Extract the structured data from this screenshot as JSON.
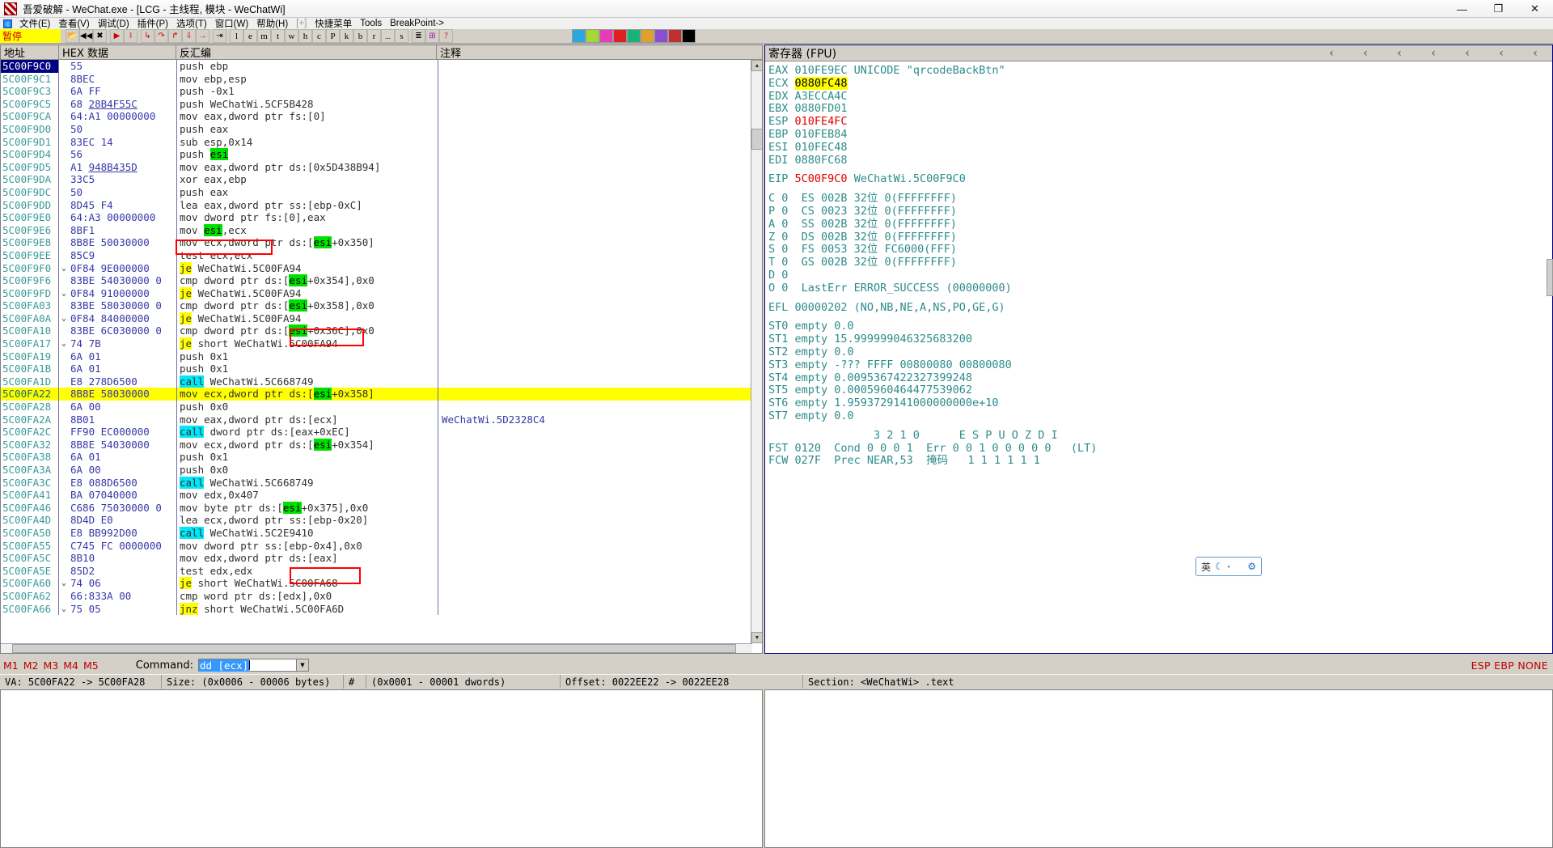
{
  "window": {
    "title": "吾爱破解 - WeChat.exe - [LCG -  主线程, 模块 - WeChatWi]",
    "minimize": "—",
    "maximize": "❐",
    "close": "✕",
    "app_icon": "app-logo-icon"
  },
  "menu": {
    "items": [
      {
        "label": "文件(E)"
      },
      {
        "label": "查看(V)"
      },
      {
        "label": "调试(D)"
      },
      {
        "label": "插件(P)"
      },
      {
        "label": "选项(T)"
      },
      {
        "label": "窗口(W)"
      },
      {
        "label": "帮助(H)"
      },
      {
        "label": "[+]",
        "dim": true
      },
      {
        "label": "快捷菜单"
      },
      {
        "label": "Tools"
      },
      {
        "label": "BreakPoint->"
      }
    ]
  },
  "toolbar": {
    "status_label": "暂停",
    "buttons": [
      {
        "name": "open-file-button",
        "glyph": "📂"
      },
      {
        "name": "restart-button",
        "glyph": "◀◀"
      },
      {
        "name": "close-button",
        "glyph": "✖"
      },
      {
        "name": "run-button",
        "glyph": "▶"
      },
      {
        "name": "pause-button",
        "glyph": "‖"
      },
      {
        "name": "step-into-button",
        "glyph": "↳"
      },
      {
        "name": "step-over-button",
        "glyph": "↷"
      },
      {
        "name": "step-out-button",
        "glyph": "↱"
      },
      {
        "name": "run-to-return-button",
        "glyph": "⇩"
      },
      {
        "name": "execute-till-return-button",
        "glyph": "→"
      },
      {
        "name": "run-to-selection-button",
        "glyph": "⇥"
      }
    ],
    "letters": [
      "l",
      "e",
      "m",
      "t",
      "w",
      "h",
      "c",
      "P",
      "k",
      "b",
      "r"
    ],
    "letters2": [
      "s"
    ],
    "more_label": "...",
    "extra_buttons": [
      {
        "name": "list-view-button",
        "glyph": "≣"
      },
      {
        "name": "window-list-button",
        "glyph": "⊞"
      },
      {
        "name": "help-button",
        "glyph": "?"
      }
    ],
    "color_buttons": [
      {
        "name": "patch-icon",
        "color": "#29a7e0"
      },
      {
        "name": "hide-icon",
        "color": "#a5d833"
      },
      {
        "name": "attach-icon",
        "color": "#e93bb4"
      },
      {
        "name": "scylla-icon",
        "color": "#e02020"
      },
      {
        "name": "plugin1-icon",
        "color": "#19b37a"
      },
      {
        "name": "plugin2-icon",
        "color": "#e0a030"
      },
      {
        "name": "plugin3-icon",
        "color": "#8a4fd0"
      },
      {
        "name": "plugin4-icon",
        "color": "#c03030"
      },
      {
        "name": "black-icon",
        "color": "#000000"
      }
    ]
  },
  "disasm": {
    "headers": [
      "地址",
      "HEX 数据",
      "反汇编",
      "注释"
    ],
    "rows": [
      {
        "addr": "5C00F9C0",
        "hex": "55",
        "asm": "push ebp",
        "cmt": "",
        "selected": true
      },
      {
        "addr": "5C00F9C1",
        "hex": "8BEC",
        "asm": "mov ebp,esp",
        "cmt": ""
      },
      {
        "addr": "5C00F9C3",
        "hex": "6A FF",
        "asm": "push -0x1",
        "cmt": ""
      },
      {
        "addr": "5C00F9C5",
        "hex": "68 28B4F55C",
        "asm": "push WeChatWi.5CF5B428",
        "cmt": "",
        "hex_ul": true
      },
      {
        "addr": "5C00F9CA",
        "hex": "64:A1 00000000",
        "asm": "mov eax,dword ptr fs:[0]",
        "cmt": ""
      },
      {
        "addr": "5C00F9D0",
        "hex": "50",
        "asm": "push eax",
        "cmt": ""
      },
      {
        "addr": "5C00F9D1",
        "hex": "83EC 14",
        "asm": "sub esp,0x14",
        "cmt": ""
      },
      {
        "addr": "5C00F9D4",
        "hex": "56",
        "asm": "push |esi|",
        "cmt": ""
      },
      {
        "addr": "5C00F9D5",
        "hex": "A1 948B435D",
        "asm": "mov eax,dword ptr ds:[0x5D438B94]",
        "cmt": "",
        "hex_ul": true
      },
      {
        "addr": "5C00F9DA",
        "hex": "33C5",
        "asm": "xor eax,ebp",
        "cmt": ""
      },
      {
        "addr": "5C00F9DC",
        "hex": "50",
        "asm": "push eax",
        "cmt": ""
      },
      {
        "addr": "5C00F9DD",
        "hex": "8D45 F4",
        "asm": "lea eax,dword ptr ss:[ebp-0xC]",
        "cmt": ""
      },
      {
        "addr": "5C00F9E0",
        "hex": "64:A3 00000000",
        "asm": "mov dword ptr fs:[0],eax",
        "cmt": ""
      },
      {
        "addr": "5C00F9E6",
        "hex": "8BF1",
        "asm": "mov |esi|,ecx",
        "cmt": ""
      },
      {
        "addr": "5C00F9E8",
        "hex": "8B8E 50030000",
        "asm": "mov ecx,dword ptr ds:[|esi|+0x350]",
        "cmt": ""
      },
      {
        "addr": "5C00F9EE",
        "hex": "85C9",
        "asm": "test ecx,ecx",
        "cmt": ""
      },
      {
        "addr": "5C00F9F0",
        "hex": "0F84 9E000000",
        "asm": "#je# WeChatWi.5C00FA94",
        "cmt": "",
        "arrow": "⌄"
      },
      {
        "addr": "5C00F9F6",
        "hex": "83BE 54030000 0",
        "asm": "cmp dword ptr ds:[|esi|+0x354],0x0",
        "cmt": ""
      },
      {
        "addr": "5C00F9FD",
        "hex": "0F84 91000000",
        "asm": "#je# WeChatWi.5C00FA94",
        "cmt": "",
        "arrow": "⌄"
      },
      {
        "addr": "5C00FA03",
        "hex": "83BE 58030000 0",
        "asm": "cmp dword ptr ds:[|esi|+0x358],0x0",
        "cmt": ""
      },
      {
        "addr": "5C00FA0A",
        "hex": "0F84 84000000",
        "asm": "#je# WeChatWi.5C00FA94",
        "cmt": "",
        "arrow": "⌄"
      },
      {
        "addr": "5C00FA10",
        "hex": "83BE 6C030000 0",
        "asm": "cmp dword ptr ds:[|esi|+0x36C],0x0",
        "cmt": ""
      },
      {
        "addr": "5C00FA17",
        "hex": "74 7B",
        "asm": "#je# short WeChatWi.5C00FA94",
        "cmt": "",
        "arrow": "⌄"
      },
      {
        "addr": "5C00FA19",
        "hex": "6A 01",
        "asm": "push 0x1",
        "cmt": ""
      },
      {
        "addr": "5C00FA1B",
        "hex": "6A 01",
        "asm": "push 0x1",
        "cmt": ""
      },
      {
        "addr": "5C00FA1D",
        "hex": "E8 278D6500",
        "asm": "@call@ WeChatWi.5C668749",
        "cmt": ""
      },
      {
        "addr": "5C00FA22",
        "hex": "8B8E 58030000",
        "asm": "mov ecx,dword ptr ds:[|esi|+0x358]",
        "cmt": "",
        "highlight": true
      },
      {
        "addr": "5C00FA28",
        "hex": "6A 00",
        "asm": "push 0x0",
        "cmt": ""
      },
      {
        "addr": "5C00FA2A",
        "hex": "8B01",
        "asm": "mov eax,dword ptr ds:[ecx]",
        "cmt": "WeChatWi.5D2328C4"
      },
      {
        "addr": "5C00FA2C",
        "hex": "FF90 EC000000",
        "asm": "@call@ dword ptr ds:[eax+0xEC]",
        "cmt": ""
      },
      {
        "addr": "5C00FA32",
        "hex": "8B8E 54030000",
        "asm": "mov ecx,dword ptr ds:[|esi|+0x354]",
        "cmt": ""
      },
      {
        "addr": "5C00FA38",
        "hex": "6A 01",
        "asm": "push 0x1",
        "cmt": ""
      },
      {
        "addr": "5C00FA3A",
        "hex": "6A 00",
        "asm": "push 0x0",
        "cmt": ""
      },
      {
        "addr": "5C00FA3C",
        "hex": "E8 088D6500",
        "asm": "@call@ WeChatWi.5C668749",
        "cmt": ""
      },
      {
        "addr": "5C00FA41",
        "hex": "BA 07040000",
        "asm": "mov edx,0x407",
        "cmt": ""
      },
      {
        "addr": "5C00FA46",
        "hex": "C686 75030000 0",
        "asm": "mov byte ptr ds:[|esi|+0x375],0x0",
        "cmt": ""
      },
      {
        "addr": "5C00FA4D",
        "hex": "8D4D E0",
        "asm": "lea ecx,dword ptr ss:[ebp-0x20]",
        "cmt": ""
      },
      {
        "addr": "5C00FA50",
        "hex": "E8 BB992D00",
        "asm": "@call@ WeChatWi.5C2E9410",
        "cmt": ""
      },
      {
        "addr": "5C00FA55",
        "hex": "C745 FC 0000000",
        "asm": "mov dword ptr ss:[ebp-0x4],0x0",
        "cmt": ""
      },
      {
        "addr": "5C00FA5C",
        "hex": "8B10",
        "asm": "mov edx,dword ptr ds:[eax]",
        "cmt": ""
      },
      {
        "addr": "5C00FA5E",
        "hex": "85D2",
        "asm": "test edx,edx",
        "cmt": ""
      },
      {
        "addr": "5C00FA60",
        "hex": "74 06",
        "asm": "#je# short WeChatWi.5C00FA68",
        "cmt": "",
        "arrow": "⌄"
      },
      {
        "addr": "5C00FA62",
        "hex": "66:833A 00",
        "asm": "cmp word ptr ds:[edx],0x0",
        "cmt": ""
      },
      {
        "addr": "5C00FA66",
        "hex": "75 05",
        "asm": "#jnz# short WeChatWi.5C00FA6D",
        "cmt": "",
        "arrow": "⌄"
      }
    ]
  },
  "registers": {
    "title": "寄存器 (FPU)",
    "nav_arrows": [
      "‹",
      "‹",
      "‹",
      "‹",
      "‹",
      "‹",
      "‹"
    ],
    "gp": [
      {
        "name": "EAX",
        "value": "010FE9EC",
        "extra": "UNICODE \"qrcodeBackBtn\""
      },
      {
        "name": "ECX",
        "value": "0880FC48",
        "extra": "",
        "highlight": true
      },
      {
        "name": "EDX",
        "value": "A3ECCA4C",
        "extra": ""
      },
      {
        "name": "EBX",
        "value": "0880FD01",
        "extra": ""
      },
      {
        "name": "ESP",
        "value": "010FE4FC",
        "extra": "",
        "red": true
      },
      {
        "name": "EBP",
        "value": "010FEB84",
        "extra": ""
      },
      {
        "name": "ESI",
        "value": "010FEC48",
        "extra": ""
      },
      {
        "name": "EDI",
        "value": "0880FC68",
        "extra": ""
      }
    ],
    "eip": {
      "name": "EIP",
      "value": "5C00F9C0",
      "extra": "WeChatWi.5C00F9C0"
    },
    "flags": [
      {
        "flag": "C",
        "bit": "0",
        "seg": "ES",
        "segval": "002B",
        "mode": "32位",
        "base": "0(FFFFFFFF)"
      },
      {
        "flag": "P",
        "bit": "0",
        "seg": "CS",
        "segval": "0023",
        "mode": "32位",
        "base": "0(FFFFFFFF)"
      },
      {
        "flag": "A",
        "bit": "0",
        "seg": "SS",
        "segval": "002B",
        "mode": "32位",
        "base": "0(FFFFFFFF)"
      },
      {
        "flag": "Z",
        "bit": "0",
        "seg": "DS",
        "segval": "002B",
        "mode": "32位",
        "base": "0(FFFFFFFF)"
      },
      {
        "flag": "S",
        "bit": "0",
        "seg": "FS",
        "segval": "0053",
        "mode": "32位",
        "base": "FC6000(FFF)"
      },
      {
        "flag": "T",
        "bit": "0",
        "seg": "GS",
        "segval": "002B",
        "mode": "32位",
        "base": "0(FFFFFFFF)"
      },
      {
        "flag": "D",
        "bit": "0",
        "seg": "",
        "segval": "",
        "mode": "",
        "base": ""
      },
      {
        "flag": "O",
        "bit": "0",
        "seg": "LastErr",
        "segval": "",
        "mode": "",
        "base": "ERROR_SUCCESS (00000000)"
      }
    ],
    "efl": {
      "name": "EFL",
      "value": "00000202",
      "decoded": "(NO,NB,NE,A,NS,PO,GE,G)"
    },
    "fpu": [
      {
        "name": "ST0",
        "state": "empty",
        "value": "0.0"
      },
      {
        "name": "ST1",
        "state": "empty",
        "value": "15.999999046325683200"
      },
      {
        "name": "ST2",
        "state": "empty",
        "value": "0.0"
      },
      {
        "name": "ST3",
        "state": "empty",
        "value": "-??? FFFF 00800080 00800080"
      },
      {
        "name": "ST4",
        "state": "empty",
        "value": "0.0095367422327399248"
      },
      {
        "name": "ST5",
        "state": "empty",
        "value": "0.0005960464477539062"
      },
      {
        "name": "ST6",
        "state": "empty",
        "value": "1.9593729141000000000e+10"
      },
      {
        "name": "ST7",
        "state": "empty",
        "value": "0.0"
      }
    ],
    "fpu_bits_header": "                3 2 1 0      E S P U O Z D I",
    "fst": {
      "name": "FST",
      "value": "0120",
      "cond_label": "Cond",
      "cond": "0 0 0 1",
      "err_label": "Err",
      "err": "0 0 1 0 0 0 0 0",
      "tag": "(LT)"
    },
    "fcw": {
      "name": "FCW",
      "value": "027F",
      "prec_label": "Prec",
      "prec": "NEAR,53",
      "mask_label": "掩码",
      "mask": "1 1 1 1 1 1"
    }
  },
  "ime": {
    "lang": "英",
    "moon_icon": "moon-icon",
    "dot_icon": "dot-icon",
    "gear_icon": "gear-icon"
  },
  "command": {
    "module_buttons": [
      "M1",
      "M2",
      "M3",
      "M4",
      "M5"
    ],
    "label": "Command:",
    "value": "dd [ecx]",
    "placeholder": "",
    "dropdown_icon": "chevron-down-icon",
    "right_label": "ESP EBP NONE"
  },
  "status": {
    "cells": [
      "VA: 5C00FA22 -> 5C00FA28",
      "Size: (0x0006 - 00006 bytes)",
      "#",
      "(0x0001 - 00001 dwords)",
      "Offset: 0022EE22 -> 0022EE28",
      "Section: <WeChatWi> .text"
    ]
  }
}
